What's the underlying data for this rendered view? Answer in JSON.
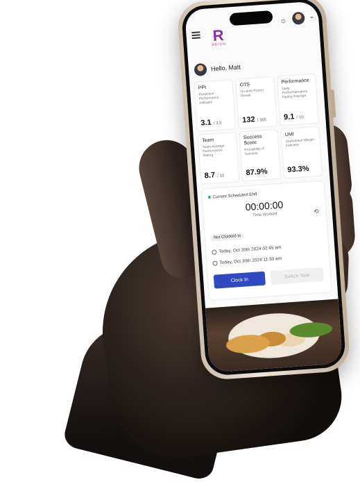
{
  "app": {
    "logo_mark": "R",
    "logo_word": "REICH",
    "icons": [
      "menu-icon",
      "sun-icon",
      "avatar",
      "chevron-down-icon"
    ]
  },
  "greeting": "Hello, Matt",
  "metrics": [
    {
      "title": "PPI",
      "desc": "Predictive Performance Indicator",
      "value": "3.1",
      "unit": "/ 3.5"
    },
    {
      "title": "OTS",
      "desc": "On-time Punch Streak",
      "value": "132",
      "unit": "/ 365"
    },
    {
      "title": "Performance",
      "desc": "Daily Performancance Rating Average",
      "value": "9.1",
      "unit": "/ 10"
    },
    {
      "title": "Team",
      "desc": "Team Average Performance Rating",
      "value": "8.7",
      "unit": "/ 10"
    },
    {
      "title": "Success Score",
      "desc": "Probability of Success",
      "value": "87.9%",
      "unit": ""
    },
    {
      "title": "UMI",
      "desc": "Usefulness Margin Indicator",
      "value": "93.3%",
      "unit": ""
    }
  ],
  "shift": {
    "current_label": "Current Scheduled Shift",
    "timer": "00:00:00",
    "timer_label": "Time Worked",
    "status": "Not Clocked In",
    "start": "Today, Oct 30th 2024 02:45 am",
    "end": "Today, Oct 30th 2024 11:30 am",
    "clock_in_label": "Clock In",
    "switch_task_label": "Switch Task"
  },
  "colors": {
    "primary": "#2f49c0",
    "brand": "#8b2fa6",
    "status_dot": "#2eb872"
  }
}
